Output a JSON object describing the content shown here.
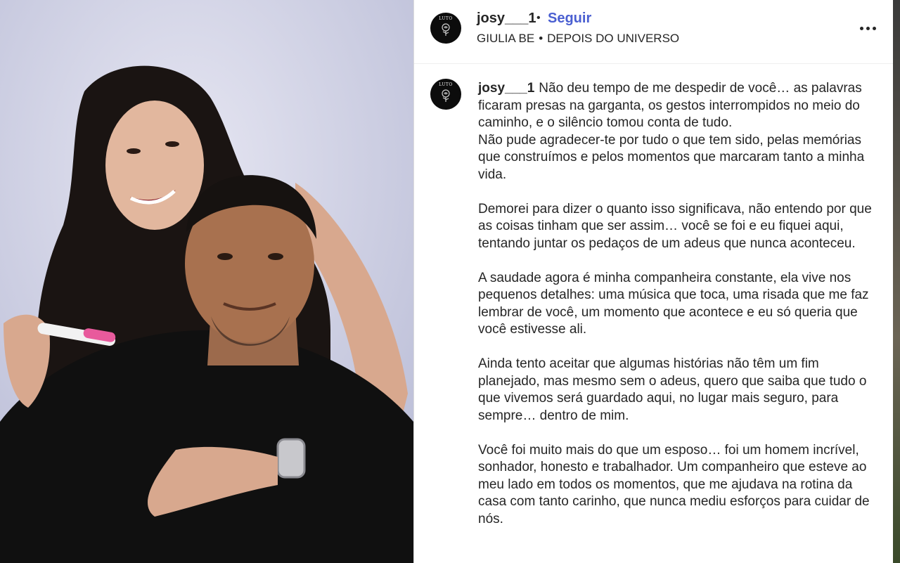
{
  "post": {
    "username": "josy___1",
    "separator": "•",
    "follow_label": "Seguir",
    "audio": {
      "artist": "GIULIA BE",
      "separator": "•",
      "track": "DEPOIS DO UNIVERSO"
    },
    "more_icon": "more-horizontal-icon",
    "avatar_text": "LUTO"
  },
  "caption": {
    "username": "josy___1",
    "paragraphs": [
      "Não deu tempo de me despedir de você… as palavras ficaram presas na garganta, os gestos interrompidos no meio do caminho, e o silêncio tomou conta de tudo.\nNão pude agradecer-te por tudo o que tem sido, pelas memórias que construímos e pelos momentos que marcaram tanto a minha vida.",
      "Demorei para dizer o quanto isso significava, não entendo por que as coisas tinham que ser assim… você se foi e eu fiquei aqui, tentando juntar os pedaços de um adeus que nunca aconteceu.",
      "A saudade agora é minha companheira constante, ela vive nos pequenos detalhes: uma música que toca, uma risada que me faz lembrar de você, um momento que acontece e eu só queria que você estivesse ali.",
      "Ainda tento aceitar que algumas histórias não têm um fim planejado, mas mesmo sem o adeus, quero que saiba que tudo o que vivemos será guardado aqui, no lugar mais seguro, para sempre… dentro de mim.",
      "Você foi muito mais do que um esposo… foi um homem incrível, sonhador, honesto e trabalhador. Um companheiro que esteve ao meu lado em todos os momentos, que me ajudava na rotina da casa com tanto carinho, que nunca mediu esforços para cuidar de nós."
    ]
  },
  "colors": {
    "link": "#4a5fd1",
    "text": "#262626",
    "photo_bg": "#cfd2e6"
  }
}
